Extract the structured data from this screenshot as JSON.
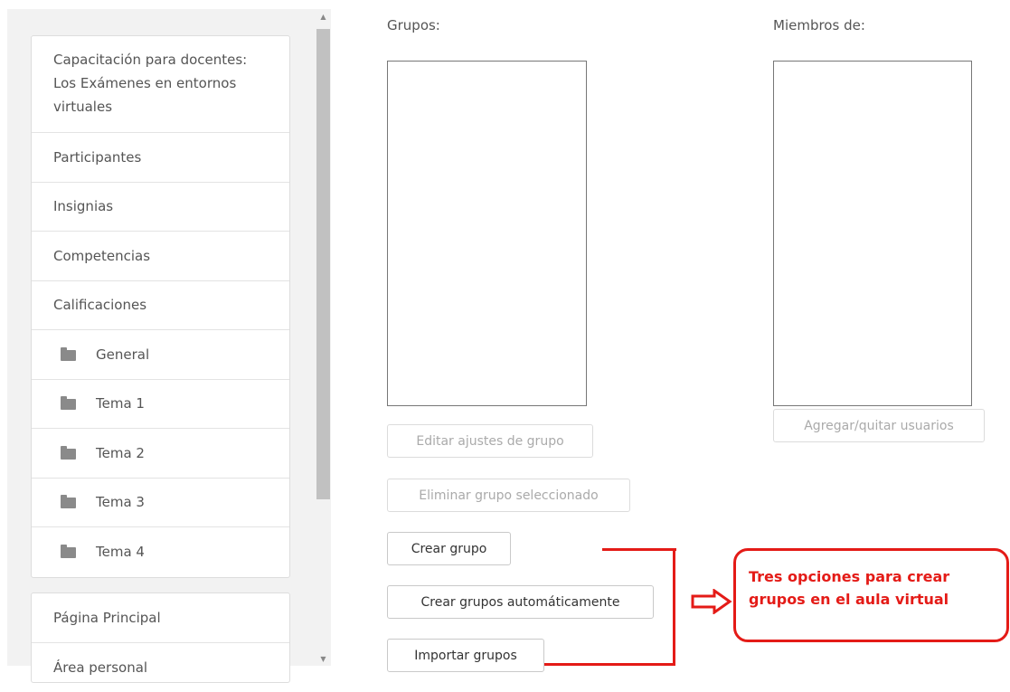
{
  "sidebar": {
    "course_title": "Capacitación para docentes: Los Exámenes en entornos virtuales",
    "items": [
      {
        "label": "Participantes"
      },
      {
        "label": "Insignias"
      },
      {
        "label": "Competencias"
      },
      {
        "label": "Calificaciones"
      }
    ],
    "sections": [
      {
        "label": "General",
        "icon": "folder-icon"
      },
      {
        "label": "Tema 1",
        "icon": "folder-icon"
      },
      {
        "label": "Tema 2",
        "icon": "folder-icon"
      },
      {
        "label": "Tema 3",
        "icon": "folder-icon"
      },
      {
        "label": "Tema 4",
        "icon": "folder-icon"
      }
    ],
    "bottom_items": [
      {
        "label": "Página Principal"
      },
      {
        "label": "Área personal"
      }
    ]
  },
  "groups_panel": {
    "groups_label": "Grupos:",
    "members_label": "Miembros de:",
    "buttons": {
      "edit_group": "Editar ajustes de grupo",
      "delete_group": "Eliminar grupo seleccionado",
      "create_group": "Crear grupo",
      "auto_create": "Crear grupos automáticamente",
      "import_groups": "Importar grupos",
      "add_remove_users": "Agregar/quitar usuarios"
    }
  },
  "annotation": {
    "line1": "Tres opciones para crear",
    "line2": "grupos en el aula virtual",
    "color": "#e41b17"
  }
}
